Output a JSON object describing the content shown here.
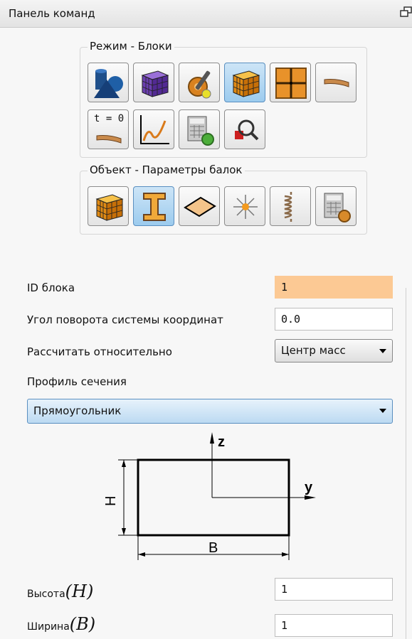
{
  "panel": {
    "title": "Панель команд"
  },
  "mode_group": {
    "title": "Режим - Блоки",
    "buttons": [
      {
        "name": "geometry-shapes-button",
        "icon": "shapes-icon",
        "active": false
      },
      {
        "name": "purple-mesh-button",
        "icon": "purple-mesh-cube-icon",
        "active": false
      },
      {
        "name": "tools-settings-button",
        "icon": "wrench-gear-icon",
        "active": false
      },
      {
        "name": "blocks-button",
        "icon": "orange-block-cube-icon",
        "active": true
      },
      {
        "name": "grid-plane-button",
        "icon": "grid-plane-icon",
        "active": false
      },
      {
        "name": "beam-button",
        "icon": "beam-strip-icon",
        "active": false
      },
      {
        "name": "time-zero-button",
        "icon": "time-zero-beam-icon",
        "label": "t = 0",
        "active": false
      },
      {
        "name": "graph-button",
        "icon": "graph-chart-icon",
        "active": false
      },
      {
        "name": "calculator-button",
        "icon": "calculator-gear-icon",
        "active": false
      },
      {
        "name": "search-inspect-button",
        "icon": "magnifier-icon",
        "active": false
      }
    ]
  },
  "object_group": {
    "title": "Объект - Параметры балок",
    "buttons": [
      {
        "name": "block-object-button",
        "icon": "orange-block-cube-icon",
        "active": false
      },
      {
        "name": "ibeam-params-button",
        "icon": "ibeam-icon",
        "active": true
      },
      {
        "name": "plate-button",
        "icon": "plate-rhombus-icon",
        "active": false
      },
      {
        "name": "point-light-button",
        "icon": "point-star-icon",
        "active": false
      },
      {
        "name": "spring-button",
        "icon": "spring-icon",
        "active": false
      },
      {
        "name": "calculator-settings-button",
        "icon": "calculator-gear-icon",
        "active": false
      }
    ]
  },
  "form": {
    "block_id_label": "ID блока",
    "block_id_value": "1",
    "rotation_label": "Угол поворота системы координат",
    "rotation_value": "0.0",
    "calc_label": "Рассчитать относительно",
    "calc_value": "Центр масс",
    "profile_label": "Профиль сечения",
    "profile_value": "Прямоугольник",
    "height_label": "Высота",
    "height_symbol": "(H)",
    "height_value": "1",
    "width_label": "Ширина",
    "width_symbol": "(B)",
    "width_value": "1"
  },
  "diagram": {
    "axis_z": "z",
    "axis_y": "y",
    "dim_h": "H",
    "dim_b": "B"
  },
  "colors": {
    "highlight_input": "#fcc994",
    "active_button": "#9ccbee",
    "accent_border": "#5a8fc0"
  }
}
